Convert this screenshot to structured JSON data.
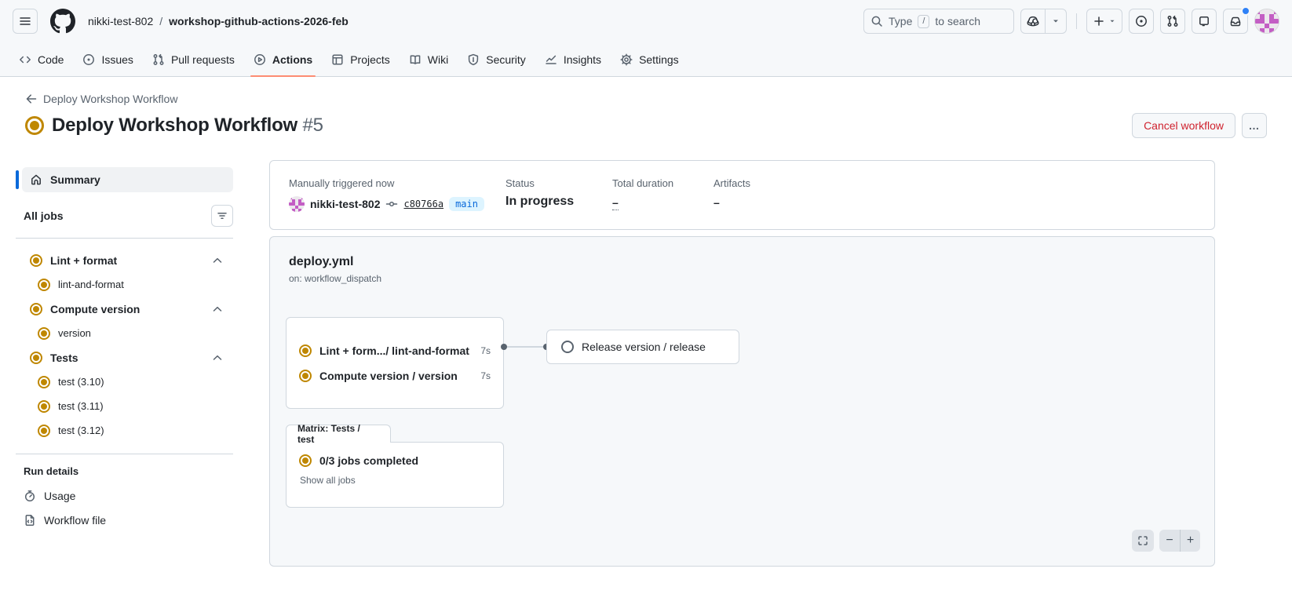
{
  "colors": {
    "header_bg": "#f6f8fa",
    "border": "#d0d7de",
    "text": "#1f2328",
    "muted": "#59636e",
    "accent_blue": "#0969da",
    "danger_red": "#cf222e",
    "attention_progress": "#bf8700",
    "tab_underline": "#fd8c73",
    "branch_badge_bg": "#ddf4ff",
    "notification_dot": "#2f81f7"
  },
  "header": {
    "breadcrumb": {
      "owner": "nikki-test-802",
      "separator": "/",
      "repo": "workshop-github-actions-2026-feb"
    },
    "search": {
      "prefix": "Type",
      "key": "/",
      "suffix": "to search"
    },
    "nav_tabs": [
      {
        "label": "Code"
      },
      {
        "label": "Issues"
      },
      {
        "label": "Pull requests"
      },
      {
        "label": "Actions"
      },
      {
        "label": "Projects"
      },
      {
        "label": "Wiki"
      },
      {
        "label": "Security"
      },
      {
        "label": "Insights"
      },
      {
        "label": "Settings"
      }
    ]
  },
  "page": {
    "back_link": "Deploy Workshop Workflow",
    "title": "Deploy Workshop Workflow",
    "run_number": "#5",
    "cancel_button": "Cancel workflow",
    "kebab_label": "…"
  },
  "sidebar": {
    "summary_label": "Summary",
    "all_jobs_label": "All jobs",
    "groups": [
      {
        "label": "Lint + format",
        "jobs": [
          "lint-and-format"
        ]
      },
      {
        "label": "Compute version",
        "jobs": [
          "version"
        ]
      },
      {
        "label": "Tests",
        "jobs": [
          "test (3.10)",
          "test (3.11)",
          "test (3.12)"
        ]
      }
    ],
    "run_details": {
      "heading": "Run details",
      "items": [
        "Usage",
        "Workflow file"
      ]
    }
  },
  "status_card": {
    "trigger_label": "Manually triggered now",
    "actor": "nikki-test-802",
    "commit": "c80766a",
    "branch": "main",
    "columns": [
      {
        "label": "Status",
        "value": "In progress"
      },
      {
        "label": "Total duration",
        "value": "–"
      },
      {
        "label": "Artifacts",
        "value": "–"
      }
    ]
  },
  "graph_card": {
    "workflow_file": "deploy.yml",
    "trigger": "on: workflow_dispatch",
    "group_nodes": [
      {
        "label": "Lint + form.../ lint-and-format",
        "duration": "7s",
        "status": "in_progress"
      },
      {
        "label": "Compute version / version",
        "duration": "7s",
        "status": "in_progress"
      }
    ],
    "release_node": {
      "label": "Release version / release",
      "status": "queued"
    },
    "matrix": {
      "tab_label": "Matrix: Tests / test",
      "summary": "0/3 jobs completed",
      "link": "Show all jobs"
    },
    "zoom_controls": {
      "minus": "−",
      "plus": "+"
    }
  }
}
